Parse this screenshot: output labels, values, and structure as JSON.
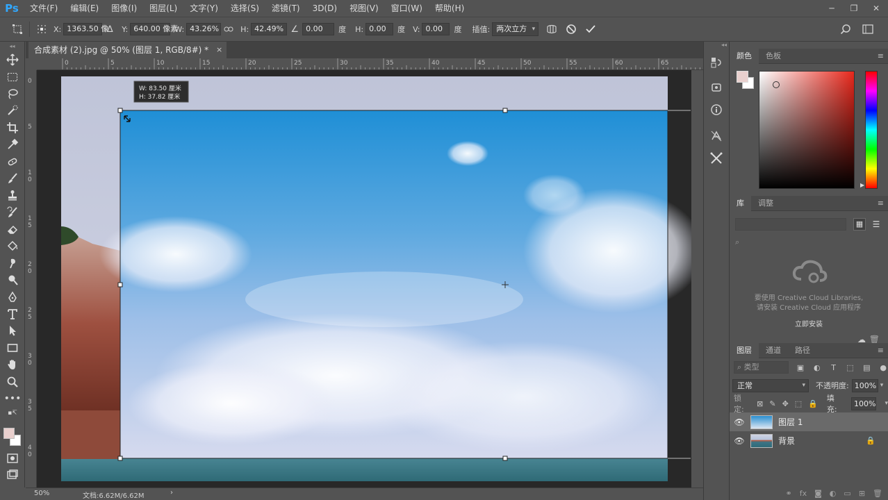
{
  "app": {
    "logo": "Ps"
  },
  "menu": [
    "文件(F)",
    "编辑(E)",
    "图像(I)",
    "图层(L)",
    "文字(Y)",
    "选择(S)",
    "滤镜(T)",
    "3D(D)",
    "视图(V)",
    "窗口(W)",
    "帮助(H)"
  ],
  "window_controls": {
    "minimize": "─",
    "restore": "❐",
    "close": "✕"
  },
  "options": {
    "x_label": "X:",
    "x_value": "1363.50 像",
    "y_label": "Y:",
    "y_value": "640.00 像素",
    "w_label": "W:",
    "w_value": "43.26%",
    "h_label": "H:",
    "h_value": "42.49%",
    "angle_value": "0.00",
    "angle_unit": "度",
    "hskew_label": "H:",
    "hskew_value": "0.00",
    "hskew_unit": "度",
    "vskew_label": "V:",
    "vskew_value": "0.00",
    "vskew_unit": "度",
    "interp_label": "插值:",
    "interp_value": "两次立方"
  },
  "document": {
    "tab_title": "合成素材 (2).jpg @ 50% (图层 1, RGB/8#) *",
    "tab_close": "×",
    "transform_tooltip": {
      "w_line": "W:  83.50 厘米",
      "h_line": "H:  37.82 厘米"
    }
  },
  "ruler_h_labels": [
    "0",
    "5",
    "10",
    "15",
    "20",
    "25",
    "30",
    "35",
    "40",
    "45",
    "50",
    "55",
    "60",
    "65"
  ],
  "ruler_v_labels": [
    "0",
    "5",
    "1 0",
    "1 5",
    "2 0",
    "2 5",
    "3 0",
    "3 5",
    "4 0"
  ],
  "status": {
    "zoom": "50%",
    "doc": "文档:6.62M/6.62M",
    "arrow": "›"
  },
  "panels": {
    "color_tabs": [
      "颜色",
      "色板"
    ],
    "foreground_color": "#e9d0ce",
    "background_color": "#ffffff",
    "library_tabs": [
      "库",
      "调整"
    ],
    "library_message_1": "要使用 Creative Cloud Libraries,",
    "library_message_2": "请安装 Creative Cloud 应用程序",
    "library_message_3": "立即安装",
    "layers_tabs": [
      "图层",
      "通道",
      "路径"
    ],
    "layers_filter_kind": "类型",
    "blend_mode": "正常",
    "opacity_label": "不透明度:",
    "opacity_value": "100%",
    "lock_label": "锁定:",
    "fill_label": "填充:",
    "fill_value": "100%",
    "layers": [
      {
        "name": "图层 1",
        "selected": true
      },
      {
        "name": "背景",
        "selected": false,
        "locked": true
      }
    ],
    "layers_footer": [
      "link-icon",
      "fx-icon",
      "mask-icon",
      "adjustment-icon",
      "group-icon",
      "new-layer-icon",
      "trash-icon"
    ]
  },
  "colors": {
    "ps_blue": "#31a8ff",
    "ui_dark": "#535353",
    "canvas_bg": "#282828"
  }
}
